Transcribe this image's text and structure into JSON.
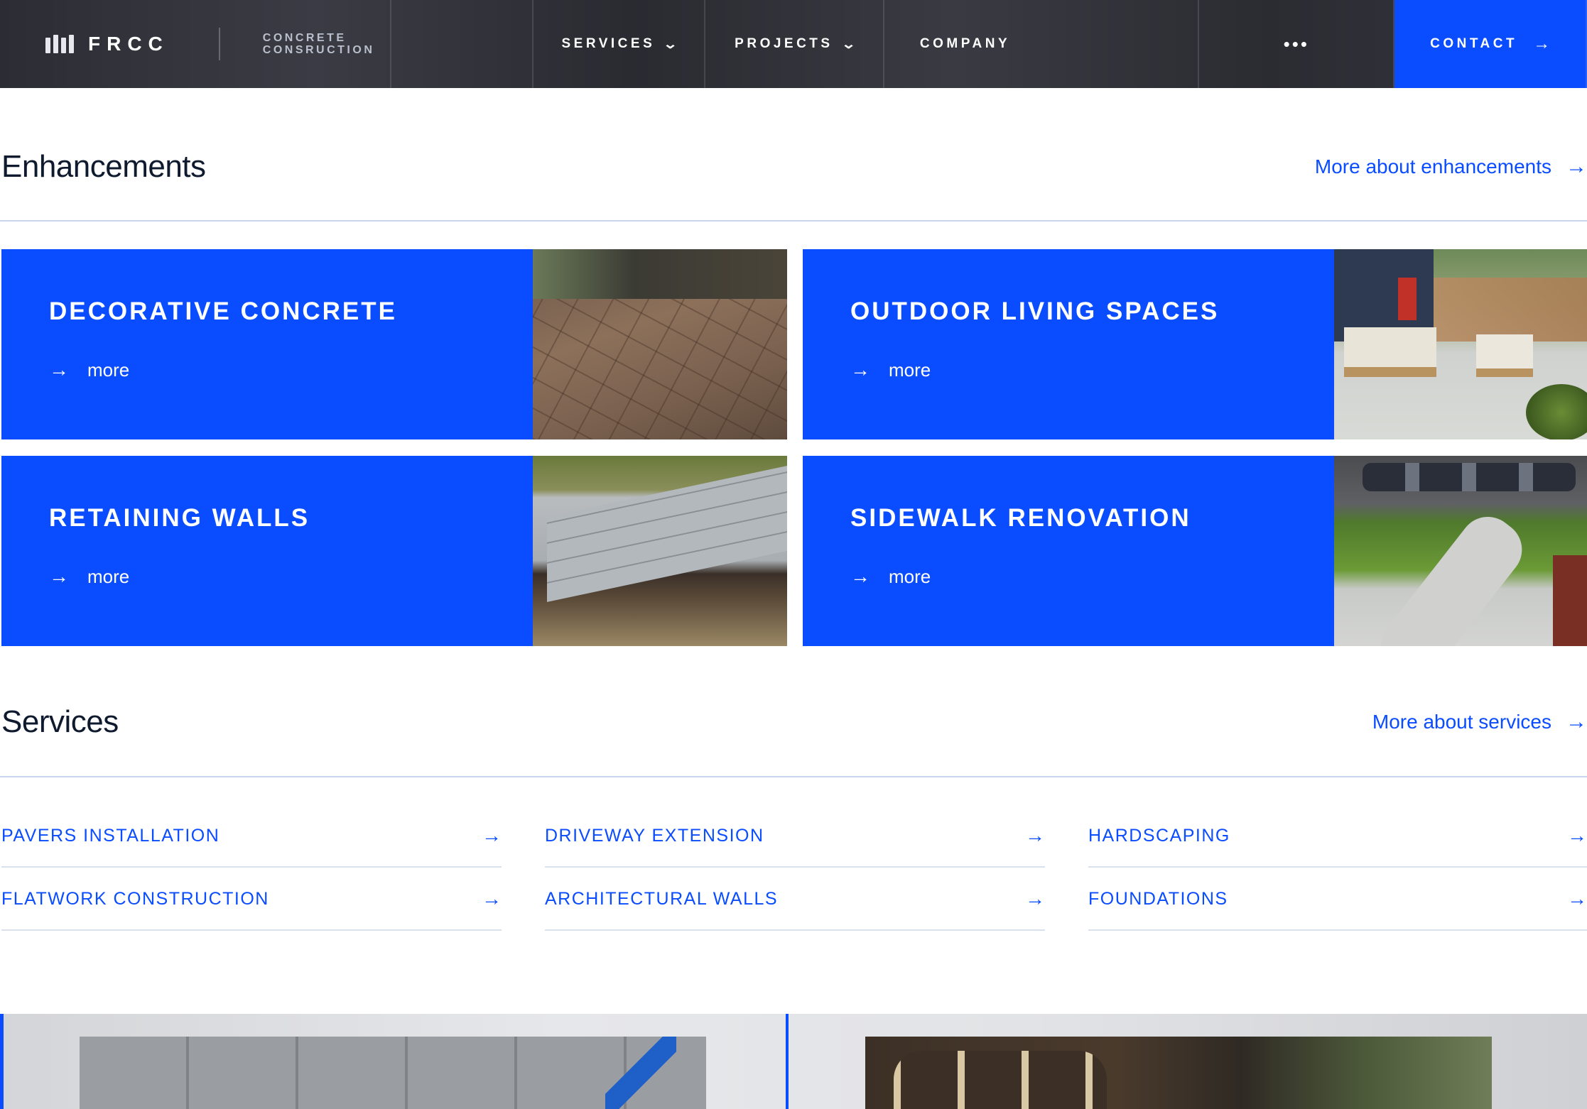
{
  "nav": {
    "brand_name": "FRCC",
    "brand_tag_line1": "CONCRETE",
    "brand_tag_line2": "CONSRUCTION",
    "services": "SERVICES",
    "projects": "PROJECTS",
    "company": "COMPANY",
    "more": "•••",
    "contact": "CONTACT",
    "chevron": "⌄",
    "arrow": "→"
  },
  "enhancements": {
    "title": "Enhancements",
    "link": "More about enhancements",
    "arrow": "→",
    "cards": [
      {
        "title": "DECORATIVE CONCRETE",
        "more": "more",
        "arrow": "→",
        "photo": "stamped-concrete-patio"
      },
      {
        "title": "OUTDOOR LIVING SPACES",
        "more": "more",
        "arrow": "→",
        "photo": "backyard-patio-furniture"
      },
      {
        "title": "RETAINING WALLS",
        "more": "more",
        "arrow": "→",
        "photo": "block-retaining-wall"
      },
      {
        "title": "SIDEWALK RENOVATION",
        "more": "more",
        "arrow": "→",
        "photo": "curved-sidewalk-lawn"
      }
    ]
  },
  "services": {
    "title": "Services",
    "link": "More about services",
    "arrow": "→",
    "items": [
      {
        "label": "PAVERS INSTALLATION",
        "arrow": "→"
      },
      {
        "label": "DRIVEWAY EXTENSION",
        "arrow": "→"
      },
      {
        "label": "HARDSCAPING",
        "arrow": "→"
      },
      {
        "label": "FLATWORK CONSTRUCTION",
        "arrow": "→"
      },
      {
        "label": "ARCHITECTURAL WALLS",
        "arrow": "→"
      },
      {
        "label": "FOUNDATIONS",
        "arrow": "→"
      }
    ]
  },
  "colors": {
    "accent": "#0a4cff",
    "nav_bg": "#2e2f36",
    "text_dark": "#0f1a2e",
    "rule": "#c9d5ee"
  },
  "icons": {
    "logo": "frcc-logo-bars-icon",
    "dropdown": "chevron-down-icon",
    "overflow": "more-dots-icon",
    "arrow": "arrow-right-icon"
  }
}
